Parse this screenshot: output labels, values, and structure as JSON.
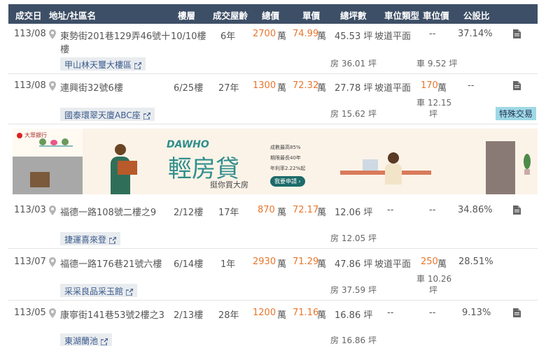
{
  "header": {
    "date": "成交日",
    "address": "地址/社區名",
    "floor": "樓層",
    "age": "成交屋齡",
    "total": "總價",
    "unit": "單價",
    "area": "總坪數",
    "parking_type": "車位類型",
    "parking_price": "車位價",
    "ratio": "公設比"
  },
  "rows": [
    {
      "date": "113/08",
      "address_line1": "東勢街201巷129弄46號十",
      "address_line2": "樓",
      "floor": "10/10樓",
      "age": "6年",
      "total": "2700",
      "total_unit": "萬",
      "unit_price": "74.99",
      "unit_unit": "萬",
      "area": "45.53 坪",
      "parking_type": "坡道平面",
      "parking_price": "--",
      "parking_unit": "",
      "ratio": "37.14%",
      "community": "甲山林天璽大樓區",
      "room": "房 36.01 坪",
      "car": "車 9.52 坪",
      "tag": ""
    },
    {
      "date": "113/08",
      "address_line1": "連興街32號6樓",
      "address_line2": "",
      "floor": "6/25樓",
      "age": "27年",
      "total": "1300",
      "total_unit": "萬",
      "unit_price": "72.32",
      "unit_unit": "萬",
      "area": "27.78 坪",
      "parking_type": "坡道平面",
      "parking_price": "170",
      "parking_unit": "萬",
      "ratio": "--",
      "community": "國泰環翠天廈ABC座",
      "room": "房 15.62 坪",
      "car": "車 12.15",
      "car2": "坪",
      "tag": "特殊交易"
    },
    {
      "date": "113/03",
      "address_line1": "福德一路108號二樓之9",
      "address_line2": "",
      "floor": "2/12樓",
      "age": "17年",
      "total": "870",
      "total_unit": "萬",
      "unit_price": "72.17",
      "unit_unit": "萬",
      "area": "12.06 坪",
      "parking_type": "--",
      "parking_price": "--",
      "parking_unit": "",
      "ratio": "34.86%",
      "community": "捷運喜來登",
      "room": "房 12.05 坪",
      "car": "",
      "tag": ""
    },
    {
      "date": "113/07",
      "address_line1": "福德一路176巷21號六樓",
      "address_line2": "",
      "floor": "6/14樓",
      "age": "1年",
      "total": "2930",
      "total_unit": "萬",
      "unit_price": "71.29",
      "unit_unit": "萬",
      "area": "47.86 坪",
      "parking_type": "坡道平面",
      "parking_price": "250",
      "parking_unit": "萬",
      "ratio": "28.51%",
      "community": "采采良品采玉館",
      "room": "房 37.59 坪",
      "car": "車 10.26",
      "car2": "坪",
      "tag": ""
    },
    {
      "date": "113/05",
      "address_line1": "康寧街141巷53號2樓之3",
      "address_line2": "",
      "floor": "2/13樓",
      "age": "28年",
      "total": "1200",
      "total_unit": "萬",
      "unit_price": "71.16",
      "unit_unit": "萬",
      "area": "16.86 坪",
      "parking_type": "--",
      "parking_price": "--",
      "parking_unit": "",
      "ratio": "9.13%",
      "community": "東湖蘭池",
      "room": "房 16.86 坪",
      "car": "",
      "tag": ""
    }
  ],
  "ad": {
    "bank": "大眾銀行",
    "brand_en": "DAWHO",
    "brand_cn": "輕房貸",
    "slogan": "挺你買大房",
    "bullets": [
      "成數最高85%",
      "期限最長40年",
      "年利率2.22%起"
    ],
    "cta": "我要申請 ›"
  },
  "colors": {
    "header_bg": "#3d4f66",
    "accent": "#e8762c",
    "link": "#3a5a8c",
    "tag_bg": "#9fd8e6"
  }
}
